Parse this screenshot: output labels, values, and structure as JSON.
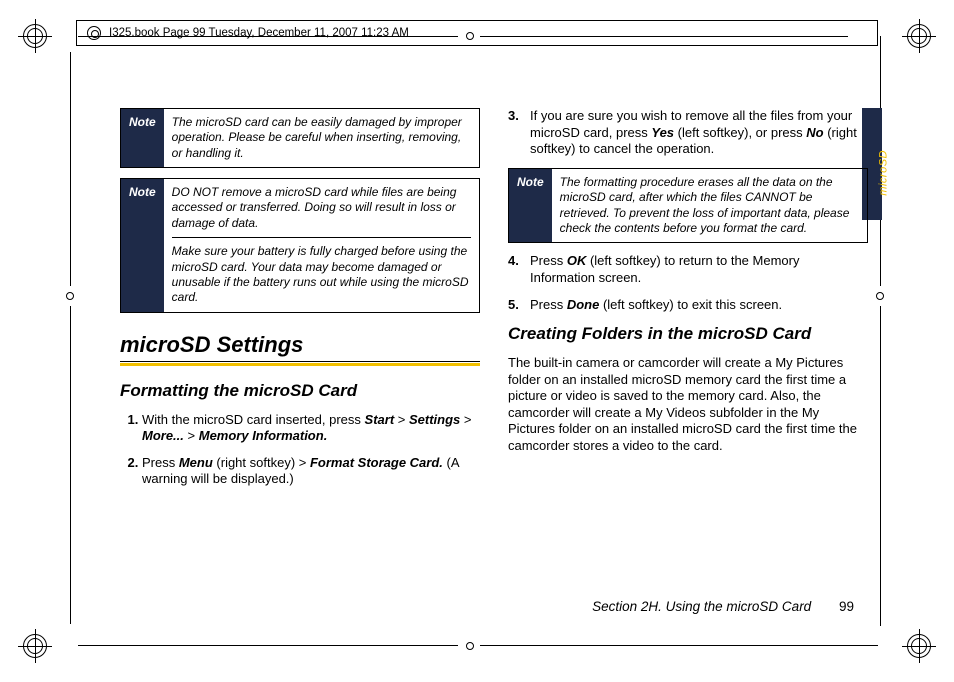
{
  "header": {
    "crop_text": "I325.book  Page 99  Tuesday, December 11, 2007  11:23 AM"
  },
  "left": {
    "note1": {
      "label": "Note",
      "text": "The microSD card can be easily damaged by improper operation. Please be careful when inserting, removing, or handling it."
    },
    "note2": {
      "label": "Note",
      "cell1": "DO NOT remove a microSD card while files are being accessed or transferred. Doing so will result in loss or damage of data.",
      "cell2": "Make sure your battery is fully charged before using the microSD card. Your data may become damaged or unusable if the battery runs out while using the microSD card."
    },
    "h1": "microSD Settings",
    "h2": "Formatting the microSD Card",
    "step1_a": "With the microSD card inserted, press ",
    "step1_b1": "Start",
    "step1_gt1": " > ",
    "step1_b2": "Settings",
    "step1_gt2": " > ",
    "step1_b3": "More...",
    "step1_gt3": " > ",
    "step1_b4": "Memory Information.",
    "step2_a": "Press ",
    "step2_b1": "Menu",
    "step2_c": " (right softkey) ",
    "step2_gt": "> ",
    "step2_b2": "Format Storage Card.",
    "step2_d": " (A warning will be displayed.)"
  },
  "right": {
    "step3_a": "If you are sure you wish to remove all the files from your microSD card, press ",
    "step3_b1": "Yes",
    "step3_c": " (left softkey), or press ",
    "step3_b2": "No",
    "step3_d": " (right softkey) to cancel the operation.",
    "note3": {
      "label": "Note",
      "text": "The formatting procedure erases all the data on the microSD card, after which the files CANNOT be retrieved. To prevent the loss of important data, please check the contents before you format the card."
    },
    "step4_a": "Press ",
    "step4_b1": "OK",
    "step4_c": " (left softkey) to return to the Memory Information screen.",
    "step5_a": "Press ",
    "step5_b1": "Done",
    "step5_c": " (left softkey) to exit this screen.",
    "h2b": "Creating Folders in the microSD Card",
    "para": "The built-in camera or camcorder will create a My Pictures folder on an installed microSD memory card the first time a picture or video is saved to the memory card. Also, the camcorder will create a My Videos subfolder in the My Pictures folder on an installed microSD card the first time the camcorder stores a video to the card."
  },
  "tab": {
    "label": "microSD"
  },
  "footer": {
    "section": "Section 2H. Using the microSD Card",
    "page": "99"
  }
}
